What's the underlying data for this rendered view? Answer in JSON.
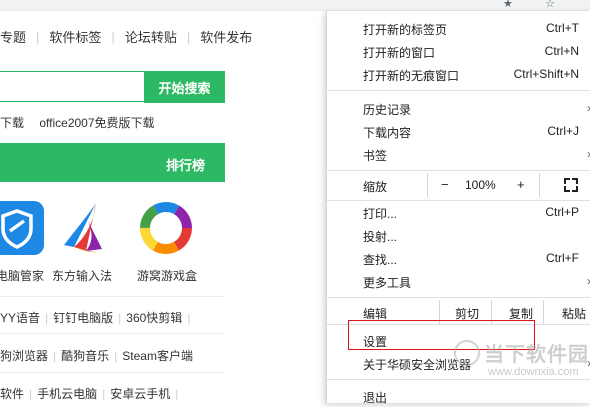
{
  "browser": {
    "star_icon": "star-icon",
    "bookmark_icon": "star-outline-icon"
  },
  "page": {
    "nav": [
      "专题",
      "软件标签",
      "论坛转贴",
      "软件发布"
    ],
    "search_button": "开始搜索",
    "hot_searches": [
      "下载",
      "office2007免费版下载"
    ],
    "rank_label": "排行榜",
    "apps": [
      {
        "name": "电脑管家",
        "icon": "shield-icon",
        "color": "#1e88e5"
      },
      {
        "name": "东方输入法",
        "icon": "feather-icon",
        "color": "#e53935"
      },
      {
        "name": "游窝游戏盒",
        "icon": "ring-icon",
        "color": "#8e24aa"
      }
    ],
    "link_rows": [
      [
        "YY语音",
        "钉钉电脑版",
        "360快剪辑"
      ],
      [
        "狗浏览器",
        "酷狗音乐",
        "Steam客户端"
      ],
      [
        "软件",
        "手机云电脑",
        "安卓云手机"
      ]
    ]
  },
  "menu": {
    "items_group1": [
      {
        "label": "打开新的标签页",
        "shortcut": "Ctrl+T"
      },
      {
        "label": "打开新的窗口",
        "shortcut": "Ctrl+N"
      },
      {
        "label": "打开新的无痕窗口",
        "shortcut": "Ctrl+Shift+N"
      }
    ],
    "items_group2": [
      {
        "label": "历史记录",
        "shortcut": ""
      },
      {
        "label": "下载内容",
        "shortcut": "Ctrl+J"
      },
      {
        "label": "书签",
        "shortcut": ""
      }
    ],
    "zoom": {
      "label": "缩放",
      "minus": "−",
      "value": "100%",
      "plus": "+"
    },
    "items_group3": [
      {
        "label": "打印...",
        "shortcut": "Ctrl+P"
      },
      {
        "label": "投射...",
        "shortcut": ""
      },
      {
        "label": "查找...",
        "shortcut": "Ctrl+F"
      },
      {
        "label": "更多工具",
        "shortcut": ""
      }
    ],
    "edit": {
      "label": "编辑",
      "cut": "剪切",
      "copy": "复制",
      "paste": "粘贴"
    },
    "settings": "设置",
    "about": "关于华硕安全浏览器",
    "exit": "退出"
  },
  "watermark": {
    "text": "当下软件园",
    "url": "www.downxia.com"
  }
}
